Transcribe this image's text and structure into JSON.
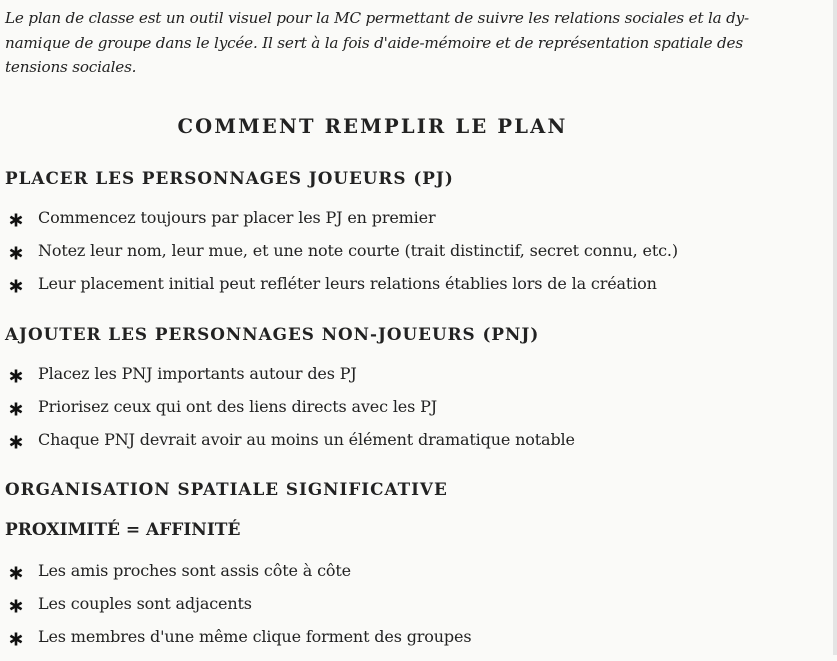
{
  "intro": "Le plan de classe est un outil visuel pour la MC permettant de suivre les relations sociales et la dynamique de groupe dans le lycée. Il sert à la fois d'aide-mémoire et de représentation spatiale des tensions sociales.",
  "title": "COMMENT REMPLIR LE PLAN",
  "sections": [
    {
      "heading": "PLACER LES PERSONNAGES JOUEURS (PJ)",
      "items": [
        "Commencez toujours par placer les PJ en premier",
        "Notez leur nom, leur mue, et une note courte (trait distinctif, secret connu, etc.)",
        "Leur placement initial peut refléter leurs relations établies lors de la création"
      ]
    },
    {
      "heading": "AJOUTER LES PERSONNAGES NON-JOUEURS (PNJ)",
      "items": [
        "Placez les PNJ importants autour des PJ",
        "Priorisez ceux qui ont des liens directs avec les PJ",
        "Chaque PNJ devrait avoir au moins un élément dramatique notable"
      ]
    },
    {
      "heading": "ORGANISATION SPATIALE SIGNIFICATIVE",
      "subheading": "PROXIMITÉ = AFFINITÉ",
      "items": [
        "Les amis proches sont assis côte à côte",
        "Les couples sont adjacents",
        "Les membres d'une même clique forment des groupes"
      ]
    }
  ],
  "bullet_icon": "asterisk-icon"
}
